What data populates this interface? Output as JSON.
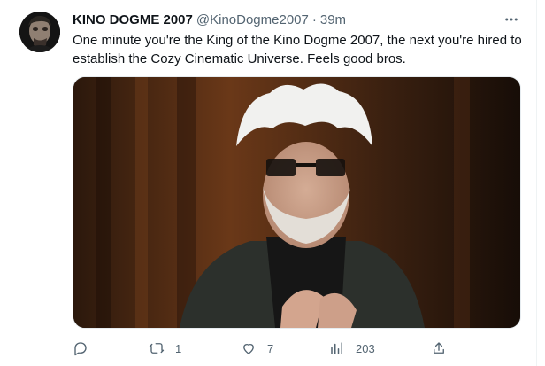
{
  "tweet": {
    "display_name": "KINO DOGME 2007",
    "handle": "@KinoDogme2007",
    "separator": "·",
    "time": "39m",
    "text": "One minute you're the King of the Kino Dogme 2007, the next you're hired to establish the Cozy Cinematic Universe. Feels good bros."
  },
  "actions": {
    "reply_icon": "reply-icon",
    "retweet_count": "1",
    "like_count": "7",
    "views_count": "203"
  },
  "icons": [
    "more-options-icon",
    "reply-icon",
    "retweet-icon",
    "like-icon",
    "views-icon",
    "share-icon"
  ]
}
